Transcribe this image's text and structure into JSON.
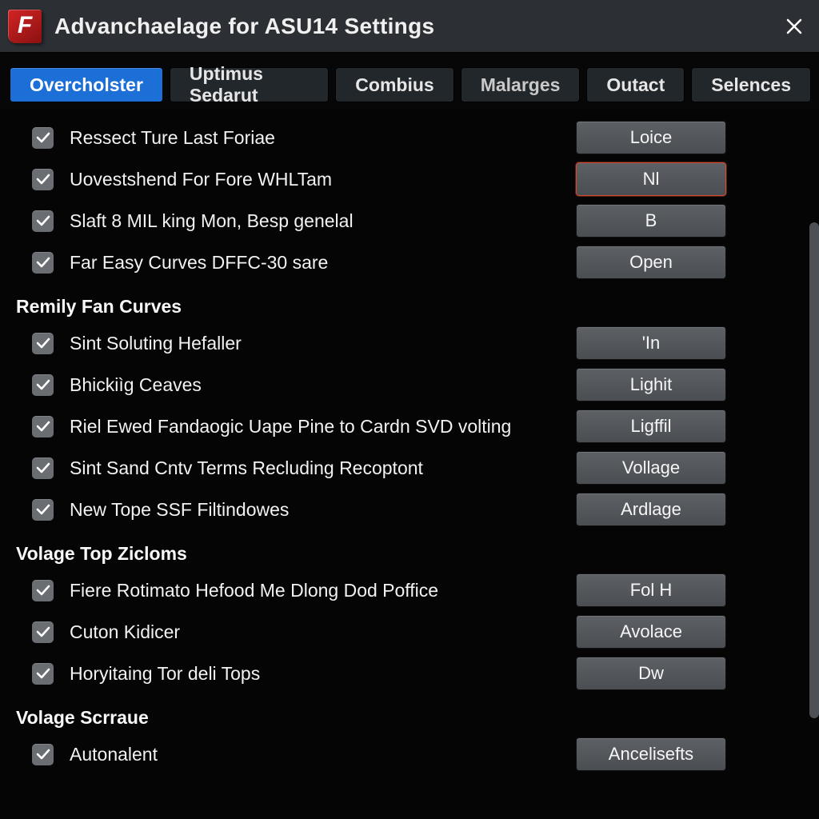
{
  "header": {
    "title": "Advanchaelage  for ASU14 Settings",
    "logo_letter": "F"
  },
  "tabs": [
    {
      "id": "overcholster",
      "label": "Overcholster",
      "active": true
    },
    {
      "id": "uptimus",
      "label": "Uptimus Sedarut",
      "active": false
    },
    {
      "id": "combius",
      "label": "Combius",
      "active": false
    },
    {
      "id": "malarges",
      "label": "Malarges",
      "active": false
    },
    {
      "id": "outact",
      "label": "Outact",
      "active": false
    },
    {
      "id": "selences",
      "label": "Selences",
      "active": false
    }
  ],
  "sections": [
    {
      "heading": null,
      "rows": [
        {
          "checked": true,
          "label": "Ressect Ture Last Foriae",
          "value": "Loice",
          "highlight": false
        },
        {
          "checked": true,
          "label": "Uovestshend For Fore WHLTam",
          "value": "Nl",
          "highlight": true
        },
        {
          "checked": true,
          "label": "Slaft 8 MIL king Mon, Besp genelal",
          "value": "B",
          "highlight": false
        },
        {
          "checked": true,
          "label": "Far Easy Curves DFFC-30 sare",
          "value": "Open",
          "highlight": false
        }
      ]
    },
    {
      "heading": "Remily Fan Curves",
      "rows": [
        {
          "checked": true,
          "label": "Sint Soluting Hefaller",
          "value": "'In",
          "highlight": false
        },
        {
          "checked": true,
          "label": "Bhickiìg Ceaves",
          "value": "Lighit",
          "highlight": false
        },
        {
          "checked": true,
          "label": "Riel Ewed Fandaogic Uape Pine to Cardn SVD volting",
          "value": "Ligffil",
          "highlight": false
        },
        {
          "checked": true,
          "label": "Sint Sand Cntv Terms Recluding Recoptont",
          "value": "Vollage",
          "highlight": false
        },
        {
          "checked": true,
          "label": "New Tope SSF Filtindowes",
          "value": "Ardlage",
          "highlight": false
        }
      ]
    },
    {
      "heading": "Volage Top Zicloms",
      "rows": [
        {
          "checked": true,
          "label": "Fiere Rotimato Hefood Me Dlong Dod Poffice",
          "value": "Fol H",
          "highlight": false
        },
        {
          "checked": true,
          "label": "Cuton Kidicer",
          "value": "Avolace",
          "highlight": false
        },
        {
          "checked": true,
          "label": "Horyitaing Tor deli Tops",
          "value": "Dw",
          "highlight": false
        }
      ]
    },
    {
      "heading": "Volage Scrraue",
      "rows": [
        {
          "checked": true,
          "label": "Autonalent",
          "value": "Ancelisefts",
          "highlight": false
        }
      ]
    }
  ]
}
